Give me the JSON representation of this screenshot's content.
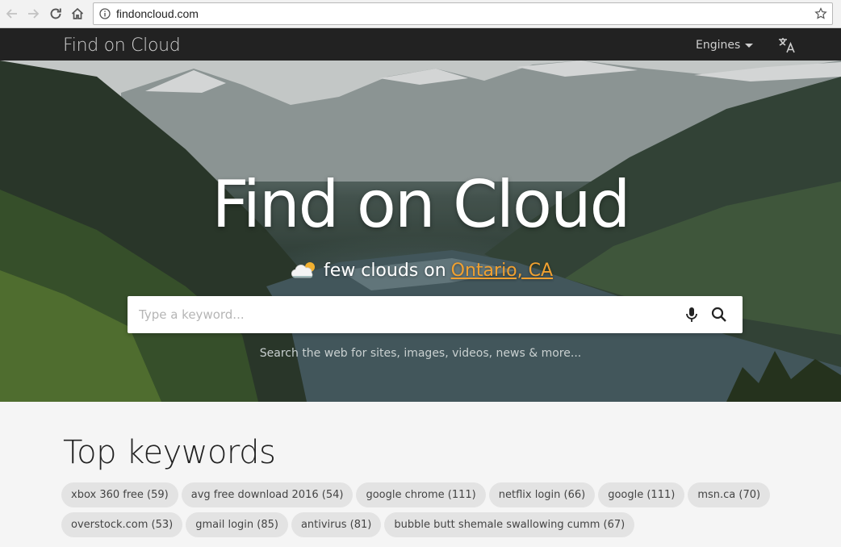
{
  "browser": {
    "url": "findoncloud.com"
  },
  "navbar": {
    "brand": "Find on Cloud",
    "engines_label": "Engines"
  },
  "hero": {
    "title": "Find on Cloud",
    "weather_text": "few clouds on",
    "location": "Ontario, CA",
    "search_placeholder": "Type a keyword...",
    "tagline": "Search the web for sites, images, videos, news & more..."
  },
  "keywords": {
    "title": "Top keywords",
    "items": [
      "xbox 360 free (59)",
      "avg free download 2016 (54)",
      "google chrome (111)",
      "netflix login (66)",
      "google (111)",
      "msn.ca (70)",
      "overstock.com (53)",
      "gmail login (85)",
      "antivirus (81)",
      "bubble butt shemale swallowing cumm (67)"
    ]
  },
  "colors": {
    "navbar_bg": "#222222",
    "location_accent": "#f0a030",
    "chip_bg": "#e3e3e3"
  },
  "icons": {
    "back": "arrow-left-icon",
    "forward": "arrow-right-icon",
    "reload": "reload-icon",
    "home": "home-icon",
    "info": "info-icon",
    "bookmark": "star-icon",
    "translate": "translate-icon",
    "weather": "cloud-sun-icon",
    "voice": "microphone-icon",
    "search": "search-icon"
  }
}
